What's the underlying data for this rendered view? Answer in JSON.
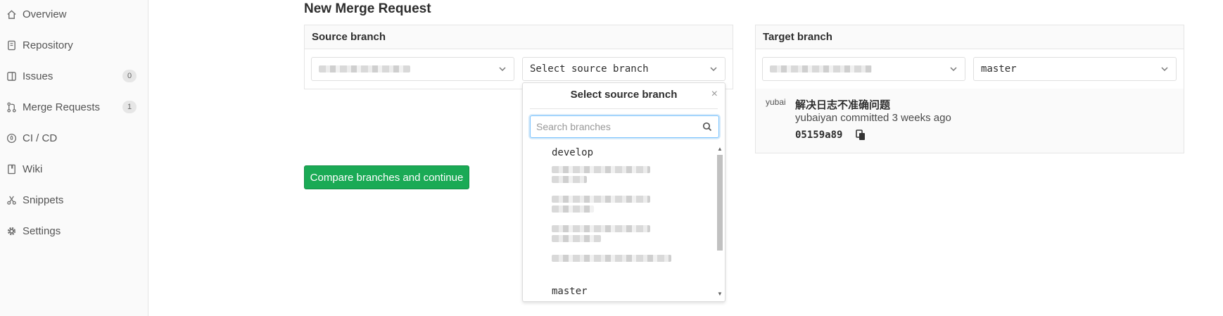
{
  "sidebar": {
    "items": [
      {
        "label": "Overview",
        "icon": "home-icon"
      },
      {
        "label": "Repository",
        "icon": "repository-icon"
      },
      {
        "label": "Issues",
        "icon": "issues-icon",
        "badge": "0"
      },
      {
        "label": "Merge Requests",
        "icon": "merge-request-icon",
        "badge": "1"
      },
      {
        "label": "CI / CD",
        "icon": "rocket-icon"
      },
      {
        "label": "Wiki",
        "icon": "book-icon"
      },
      {
        "label": "Snippets",
        "icon": "scissors-icon"
      },
      {
        "label": "Settings",
        "icon": "gear-icon"
      }
    ]
  },
  "page": {
    "title": "New Merge Request"
  },
  "source": {
    "header": "Source branch",
    "branch_select": "Select source branch"
  },
  "target": {
    "header": "Target branch",
    "branch_select": "master"
  },
  "compare_button": "Compare branches and continue",
  "dropdown": {
    "title": "Select source branch",
    "search_placeholder": "Search branches",
    "items": [
      "develop",
      "master"
    ]
  },
  "commit": {
    "avatar_alt": "yubai",
    "title": "解决日志不准确问题",
    "meta": "yubaiyan committed 3 weeks ago",
    "sha": "05159a89"
  },
  "colors": {
    "primary_green": "#1aaa55"
  }
}
